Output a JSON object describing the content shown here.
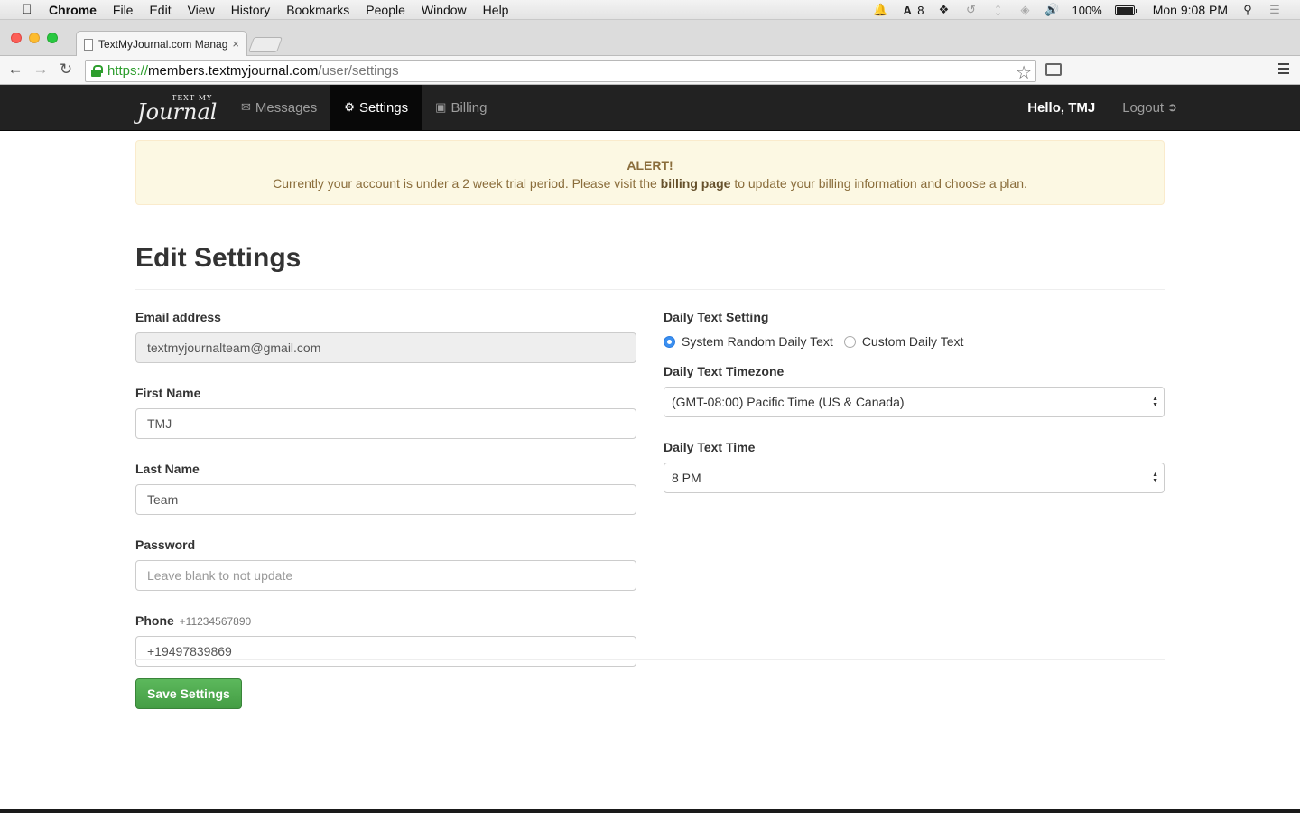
{
  "menubar": {
    "app": "Chrome",
    "items": [
      "File",
      "Edit",
      "View",
      "History",
      "Bookmarks",
      "People",
      "Window",
      "Help"
    ],
    "badge_count": "8",
    "battery": "100%",
    "battery_level": 1.0,
    "clock": "Mon 9:08 PM"
  },
  "browser": {
    "tab_title": "TextMyJournal.com Manag",
    "tab_close": "×",
    "url_scheme": "https://",
    "url_host": "members.textmyjournal.com",
    "url_path": "/user/settings"
  },
  "navbar": {
    "brand_small": "TEXT MY",
    "brand_big": "Journal",
    "links": [
      {
        "label": "Messages",
        "icon": "envelope-icon"
      },
      {
        "label": "Settings",
        "icon": "gear-icon"
      },
      {
        "label": "Billing",
        "icon": "credit-card-icon"
      }
    ],
    "hello": "Hello, TMJ",
    "logout": "Logout"
  },
  "alert": {
    "heading": "ALERT!",
    "text_before": "Currently your account is under a 2 week trial period. Please visit the ",
    "link": "billing page",
    "text_after": " to update your billing information and choose a plan."
  },
  "page": {
    "title": "Edit Settings"
  },
  "form": {
    "email_label": "Email address",
    "email_value": "textmyjournalteam@gmail.com",
    "first_name_label": "First Name",
    "first_name_value": "TMJ",
    "last_name_label": "Last Name",
    "last_name_value": "Team",
    "password_label": "Password",
    "password_placeholder": "Leave blank to not update",
    "phone_label": "Phone",
    "phone_hint": "+11234567890",
    "phone_value": "+19497839869",
    "daily_text_setting_label": "Daily Text Setting",
    "radio_system": "System Random Daily Text",
    "radio_custom": "Custom Daily Text",
    "timezone_label": "Daily Text Timezone",
    "timezone_value": "(GMT-08:00) Pacific Time (US & Canada)",
    "time_label": "Daily Text Time",
    "time_value": "8 PM",
    "save_button": "Save Settings"
  },
  "colors": {
    "navbar": "#222222",
    "alert_bg": "#fcf8e3",
    "save_button": "#5cb85c",
    "radio_checked": "#3b8ff0"
  }
}
